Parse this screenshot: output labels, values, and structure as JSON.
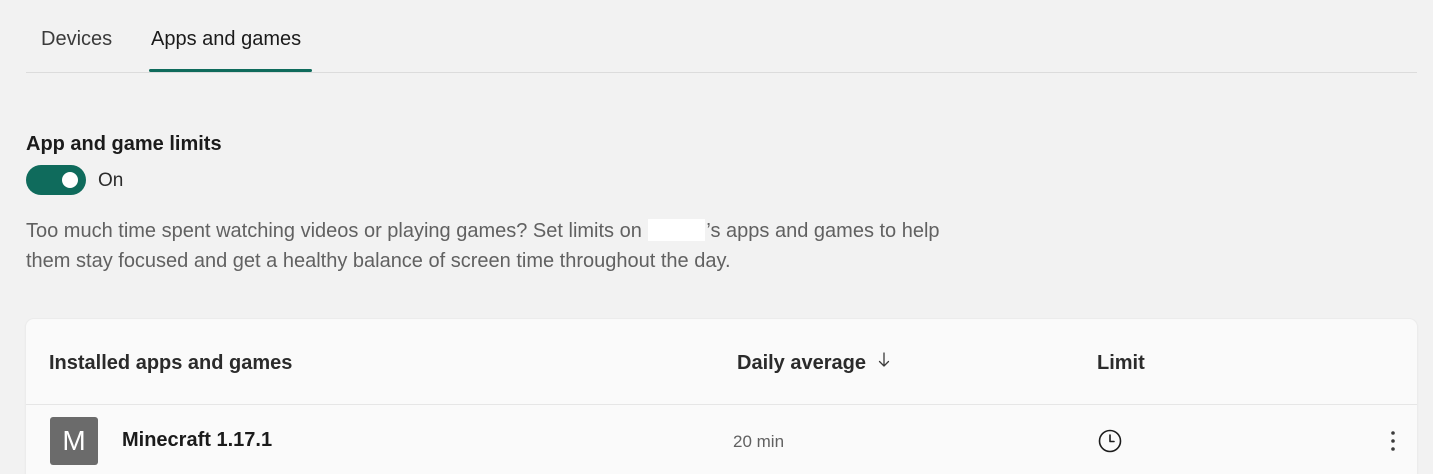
{
  "tabs": [
    {
      "label": "Devices",
      "selected": false
    },
    {
      "label": "Apps and games",
      "selected": true
    }
  ],
  "limits": {
    "title": "App and game limits",
    "toggle_state": "On",
    "toggle_on": true,
    "description_part1": "Too much time spent watching videos or playing games? Set limits on",
    "description_part2": "’s apps and games to help them stay focused and get a healthy balance of screen time throughout the day."
  },
  "table": {
    "headers": {
      "app": "Installed apps and games",
      "average": "Daily average",
      "limit": "Limit"
    },
    "sort_icon": "arrow-down-icon",
    "rows": [
      {
        "tile_letter": "M",
        "name": "Minecraft 1.17.1",
        "average": "20 min",
        "limit_icon": "clock-icon",
        "menu_icon": "more-vertical-icon"
      }
    ]
  },
  "colors": {
    "accent": "#0f6b5c",
    "background": "#f2f2f2",
    "card": "#fafafa",
    "tile": "#6b6b6b"
  }
}
